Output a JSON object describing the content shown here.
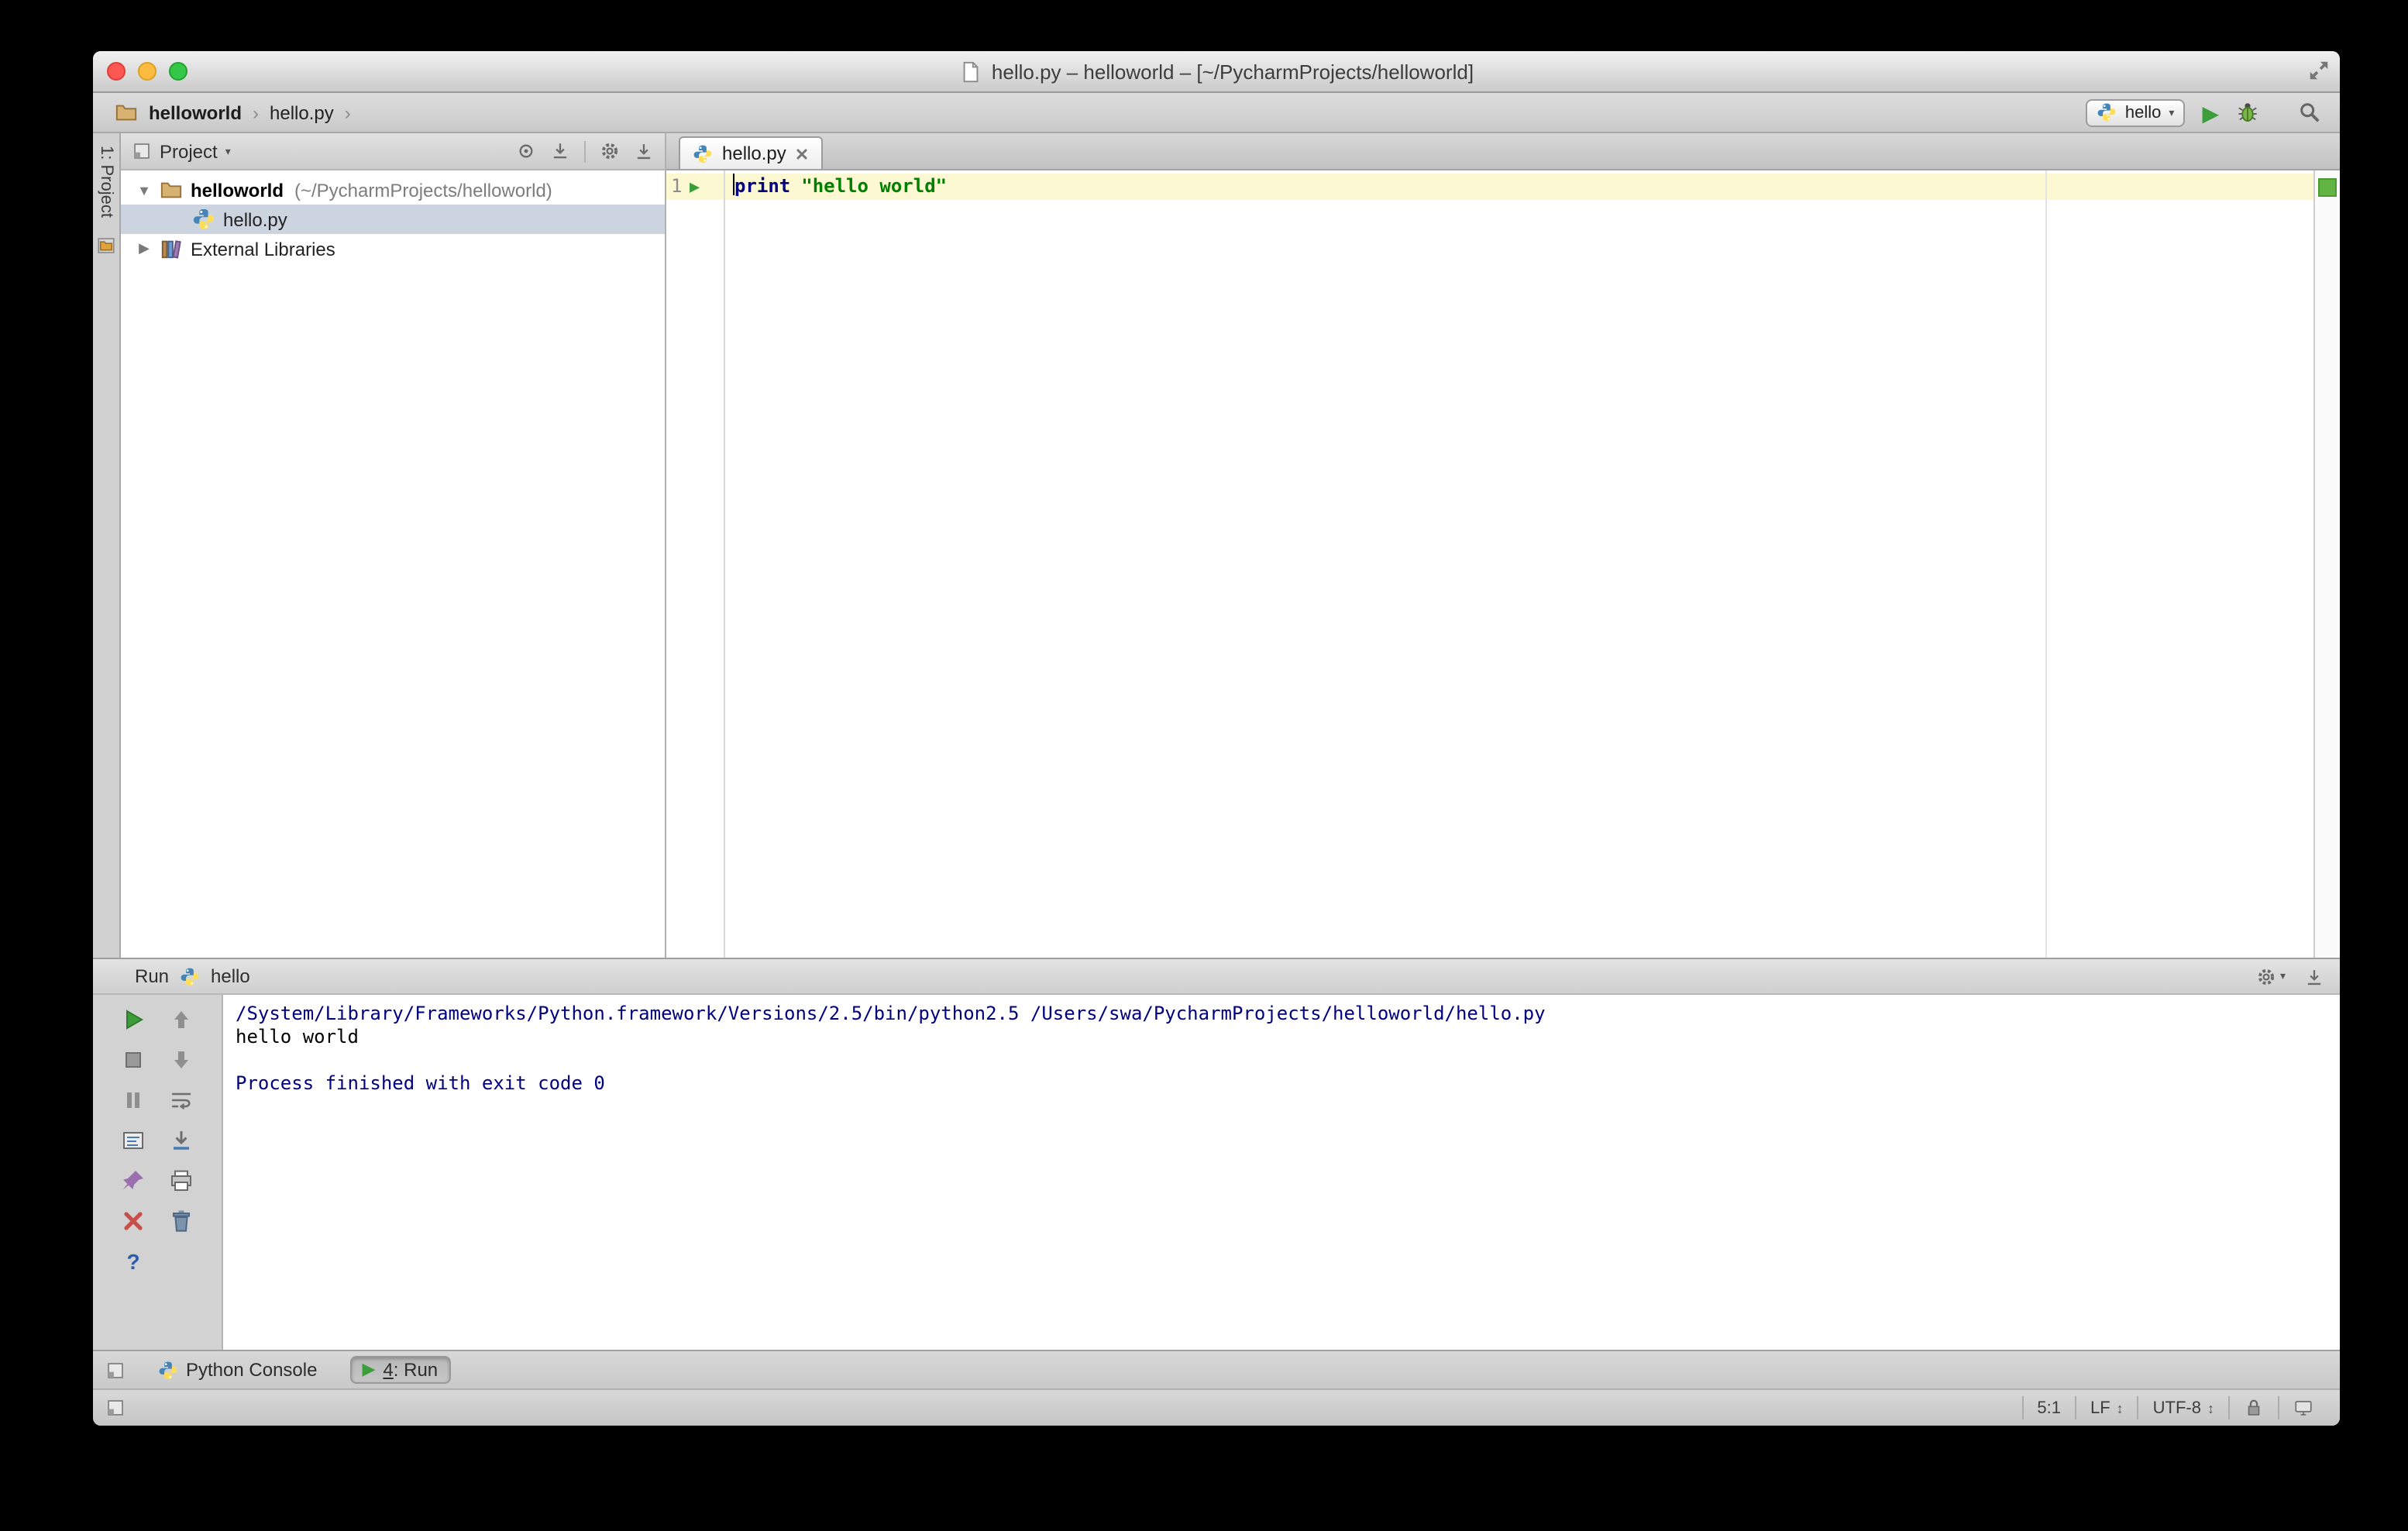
{
  "window": {
    "title": "hello.py – helloworld – [~/PycharmProjects/helloworld]"
  },
  "toolbar": {
    "breadcrumb_project": "helloworld",
    "breadcrumb_file": "hello.py",
    "run_config": "hello"
  },
  "tool_strip": {
    "project_button": "1: Project"
  },
  "project_panel": {
    "view_selector": "Project",
    "tree": {
      "root_name": "helloworld",
      "root_path": "(~/PycharmProjects/helloworld)",
      "file": "hello.py",
      "external_libraries": "External Libraries"
    }
  },
  "editor": {
    "tab_title": "hello.py",
    "line_number": "1",
    "code_keyword": "print",
    "code_string": "\"hello world\""
  },
  "run_panel": {
    "title": "Run",
    "config_name": "hello",
    "console": [
      "/System/Library/Frameworks/Python.framework/Versions/2.5/bin/python2.5 /Users/swa/PycharmProjects/helloworld/hello.py",
      "hello world",
      "",
      "Process finished with exit code 0"
    ]
  },
  "bottom_bar": {
    "python_console": "Python Console",
    "run_tab_number": "4",
    "run_tab_suffix": ": Run"
  },
  "status_bar": {
    "caret_position": "5:1",
    "line_separator": "LF",
    "encoding": "UTF-8"
  },
  "icons": {
    "dropdown": "▾",
    "run": "▶",
    "chevron": "›",
    "expanded": "▼",
    "collapsed": "▶",
    "updown": "↕",
    "help": "?"
  },
  "colors": {
    "keyword": "#000080",
    "string": "#008000",
    "console_system": "#000080",
    "run_green": "#3b9e3b",
    "caret_line": "#fcf8d2",
    "selection": "#ccd5df"
  }
}
